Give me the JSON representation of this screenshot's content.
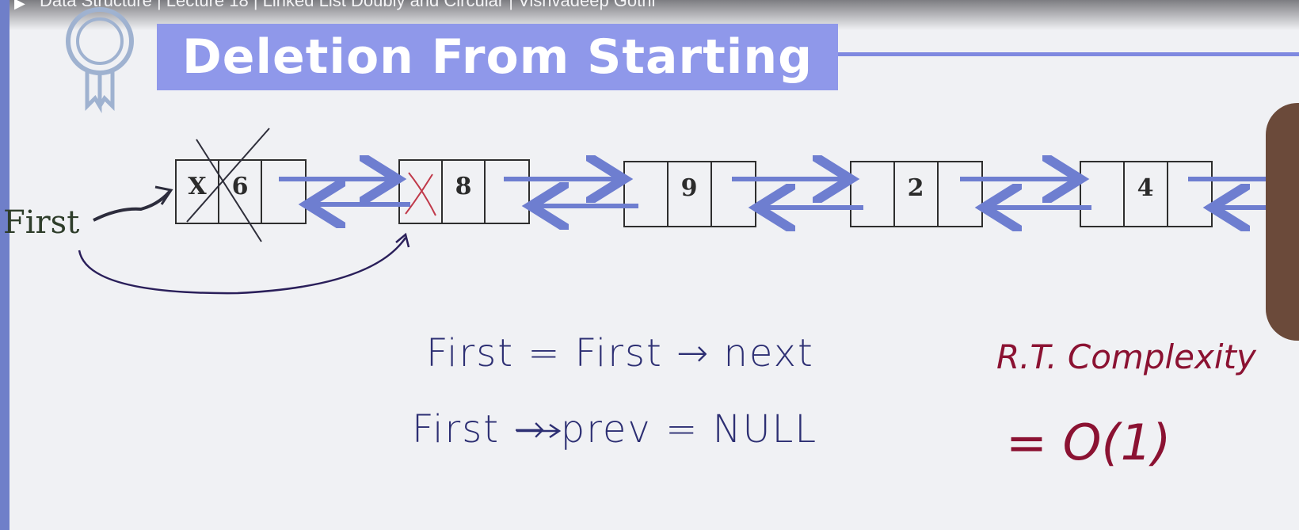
{
  "video": {
    "title": "Data Structure | Lecture 18 | Linked List Doubly and Circular | Vishvadeep Gothi"
  },
  "slide": {
    "title": "Deletion From Starting",
    "first_label": "First",
    "x_mark": "X",
    "nodes": [
      {
        "value": "6",
        "deleted": true
      },
      {
        "value": "8",
        "deleted": false
      },
      {
        "value": "9",
        "deleted": false
      },
      {
        "value": "2",
        "deleted": false
      },
      {
        "value": "4",
        "deleted": false
      }
    ]
  },
  "notes": {
    "line1": "First = First → next",
    "line2": "First → prev = NULL",
    "complexity_label": "R.T. Complexity",
    "complexity_value": "= O(1)"
  },
  "colors": {
    "title_band": "#8f98ea",
    "arrow": "#6e7ed0",
    "ink_blue": "#2d2f73",
    "ink_red": "#8b1232"
  },
  "icons": [
    "award-badge-icon",
    "play-icon"
  ]
}
